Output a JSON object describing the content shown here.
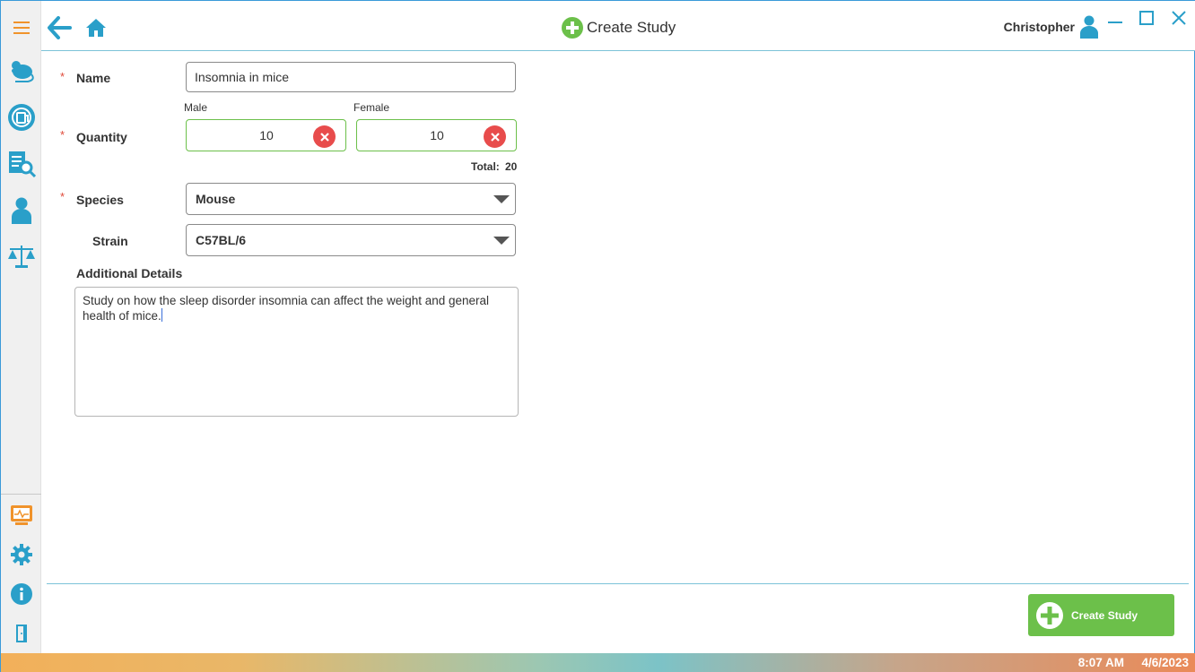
{
  "header": {
    "title": "Create Study",
    "user_name": "Christopher"
  },
  "form": {
    "name": {
      "label": "Name",
      "required_mark": "*",
      "value": "Insomnia in mice"
    },
    "quantity": {
      "label": "Quantity",
      "required_mark": "*",
      "male_label": "Male",
      "female_label": "Female",
      "male_value": "10",
      "female_value": "10",
      "total_label": "Total:",
      "total_value": "20"
    },
    "species": {
      "label": "Species",
      "required_mark": "*",
      "value": "Mouse"
    },
    "strain": {
      "label": "Strain",
      "value": "C57BL/6"
    },
    "details": {
      "label": "Additional Details",
      "value": "Study on how the sleep disorder insomnia can affect the weight and general health of mice."
    }
  },
  "footer": {
    "create_button_label": "Create Study"
  },
  "statusbar": {
    "time": "8:07 AM",
    "date": "4/6/2023"
  },
  "colors": {
    "accent_blue": "#3a9ad9",
    "accent_green": "#6cc04a",
    "error_red": "#e84c4c",
    "menu_orange": "#f0932b"
  }
}
